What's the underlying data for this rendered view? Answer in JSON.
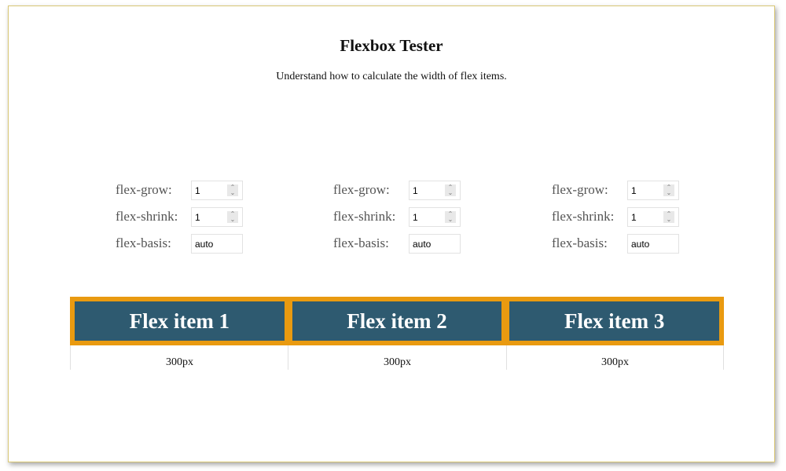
{
  "page": {
    "title": "Flexbox Tester",
    "subtitle": "Understand how to calculate the width of flex items."
  },
  "controls": [
    {
      "grow_label": "flex-grow:",
      "grow_value": "1",
      "shrink_label": "flex-shrink:",
      "shrink_value": "1",
      "basis_label": "flex-basis:",
      "basis_value": "auto"
    },
    {
      "grow_label": "flex-grow:",
      "grow_value": "1",
      "shrink_label": "flex-shrink:",
      "shrink_value": "1",
      "basis_label": "flex-basis:",
      "basis_value": "auto"
    },
    {
      "grow_label": "flex-grow:",
      "grow_value": "1",
      "shrink_label": "flex-shrink:",
      "shrink_value": "1",
      "basis_label": "flex-basis:",
      "basis_value": "auto"
    }
  ],
  "flex_items": [
    {
      "label": "Flex item 1",
      "width_label": "300px"
    },
    {
      "label": "Flex item 2",
      "width_label": "300px"
    },
    {
      "label": "Flex item 3",
      "width_label": "300px"
    }
  ],
  "colors": {
    "container_border": "#e99a10",
    "item_background": "#2e5a70",
    "item_text": "#ffffff",
    "frame_border": "#d9c774"
  },
  "icons": {
    "spinner": "number-spinner-icon"
  }
}
